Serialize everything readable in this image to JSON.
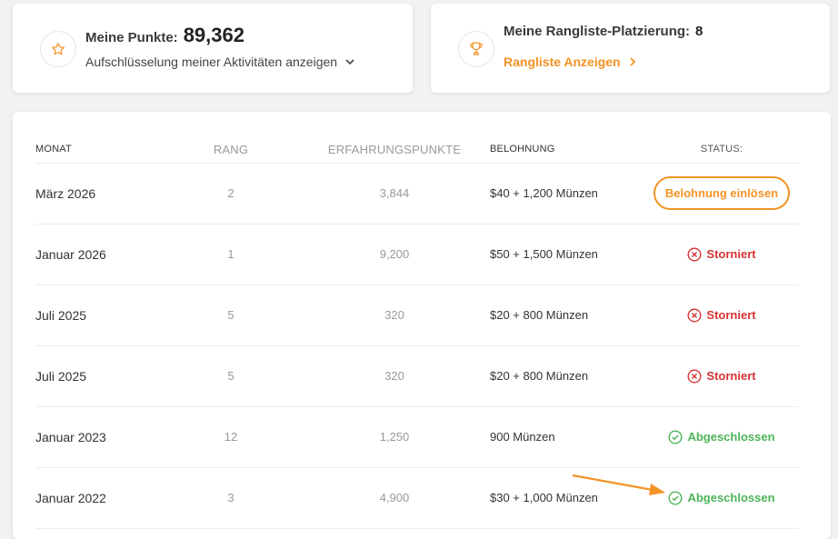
{
  "points_card": {
    "label": "Meine Punkte:",
    "value": "89,362",
    "breakdown_link": "Aufschlüsselung meiner Aktivitäten anzeigen",
    "icon": "star-icon"
  },
  "rank_card": {
    "label": "Meine Rangliste-Platzierung:",
    "value": "8",
    "link": "Rangliste Anzeigen",
    "icon": "trophy-icon"
  },
  "table": {
    "headers": {
      "month": "MONAT",
      "rank": "RANG",
      "xp": "ERFAHRUNGSPUNKTE",
      "reward": "BELOHNUNG",
      "status": "STATUS:"
    },
    "rows": [
      {
        "month": "März 2026",
        "rank": "2",
        "xp": "3,844",
        "reward": "$40 + 1,200 Münzen",
        "status": "Belohnung einlösen"
      },
      {
        "month": "Januar 2026",
        "rank": "1",
        "xp": "9,200",
        "reward": "$50 + 1,500 Münzen",
        "status": "Storniert"
      },
      {
        "month": "Juli 2025",
        "rank": "5",
        "xp": "320",
        "reward": "$20 + 800 Münzen",
        "status": "Storniert"
      },
      {
        "month": "Juli 2025",
        "rank": "5",
        "xp": "320",
        "reward": "$20 + 800 Münzen",
        "status": "Storniert"
      },
      {
        "month": "Januar 2023",
        "rank": "12",
        "xp": "1,250",
        "reward": "900 Münzen",
        "status": "Abgeschlossen"
      },
      {
        "month": "Januar 2022",
        "rank": "3",
        "xp": "4,900",
        "reward": "$30 + 1,000 Münzen",
        "status": "Abgeschlossen"
      }
    ]
  },
  "colors": {
    "accent": "#f39325",
    "cancelled": "#d63333",
    "completed": "#4cb45a"
  }
}
